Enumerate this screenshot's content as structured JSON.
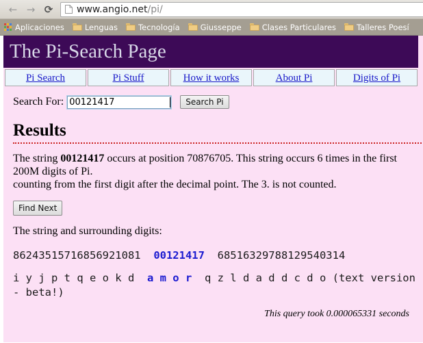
{
  "browser": {
    "back_icon": "back-arrow-icon",
    "forward_icon": "forward-arrow-icon",
    "reload_icon": "reload-icon",
    "back_label": "←",
    "forward_label": "→",
    "reload_label": "⟳",
    "url_host": "www.angio.net",
    "url_path": "/pi/",
    "url_full": "www.angio.net/pi/",
    "bookmarks": [
      {
        "label": "Aplicaciones",
        "icon": "apps-grid-icon"
      },
      {
        "label": "Lenguas",
        "icon": "folder-icon"
      },
      {
        "label": "Tecnología",
        "icon": "folder-icon"
      },
      {
        "label": "Giusseppe",
        "icon": "folder-icon"
      },
      {
        "label": "Clases Particulares",
        "icon": "folder-icon"
      },
      {
        "label": "Talleres Poesí",
        "icon": "folder-icon"
      }
    ]
  },
  "page": {
    "title": "The Pi-Search Page",
    "nav": [
      {
        "label": "Pi Search"
      },
      {
        "label": "Pi Stuff"
      },
      {
        "label": "How it works"
      },
      {
        "label": "About Pi"
      },
      {
        "label": "Digits of Pi"
      }
    ],
    "search": {
      "label": "Search For:",
      "value": "00121417",
      "placeholder": "",
      "button_label": "Search Pi"
    },
    "results": {
      "heading": "Results",
      "line1_prefix": "The string ",
      "line1_query": "00121417",
      "line1_suffix": " occurs at position 70876705. This string occurs 6 times in the first 200M digits of Pi.",
      "line2": "counting from the first digit after the decimal point. The 3. is not counted.",
      "find_next_label": "Find Next",
      "surrounding_label": "The string and surrounding digits:",
      "digits_before": "86243515716856921081",
      "digits_match": "00121417",
      "digits_after": "68516329788129540314",
      "letters_before": "i y j p t q e o k d",
      "letters_match": "a m o r",
      "letters_after": "q z l d a d d c d o (text version - beta!)",
      "footer": "This query took 0.000065331 seconds"
    }
  },
  "colors": {
    "header_purple": "#3d0a57",
    "page_pink": "#fce0f5",
    "nav_cell": "#eaf6fb",
    "link_blue": "#1616c8",
    "match_blue": "#1a1ad0",
    "hr_red": "#cc2222",
    "bookmark_bar": "#a49e92"
  }
}
